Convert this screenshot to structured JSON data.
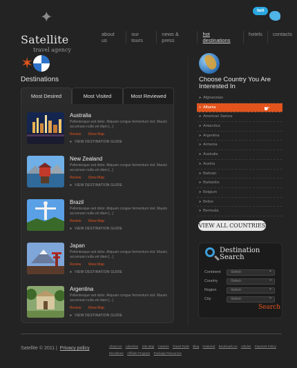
{
  "logo": {
    "name": "Satellite",
    "tagline": "travel agency"
  },
  "header": {
    "twit_label": "twit"
  },
  "nav": [
    "about us",
    "our tours",
    "news & press",
    "hot destinations",
    "hotels",
    "contacts"
  ],
  "destinations": {
    "title": "Destinations",
    "tabs": [
      "Most Desired",
      "Most Visited",
      "Most Reviewed"
    ],
    "items": [
      {
        "title": "Australia",
        "desc": "Pellentesque sed dolor. Aliquam congue fermentum nisl. Mauris accumsan nulla vel diam [...]",
        "review": "Review",
        "map": "Show Map",
        "guide": "VIEW DESTINATION GUIDE"
      },
      {
        "title": "New Zealand",
        "desc": "Pellentesque sed dolor. Aliquam congue fermentum nisl. Mauris accumsan nulla vel diam [...]",
        "review": "Review",
        "map": "Show Map",
        "guide": "VIEW DESTINATION GUIDE"
      },
      {
        "title": "Brazil",
        "desc": "Pellentesque sed dolor. Aliquam congue fermentum nisl. Mauris accumsan nulla vel diam [...]",
        "review": "Review",
        "map": "Show Map",
        "guide": "VIEW DESTINATION GUIDE"
      },
      {
        "title": "Japan",
        "desc": "Pellentesque sed dolor. Aliquam congue fermentum nisl. Mauris accumsan nulla vel diam [...]",
        "review": "Review",
        "map": "Show Map",
        "guide": "VIEW DESTINATION GUIDE"
      },
      {
        "title": "Argentina",
        "desc": "Pellentesque sed dolor. Aliquam congue fermentum nisl. Mauris accumsan nulla vel diam [...]",
        "review": "Review",
        "map": "Show Map",
        "guide": "VIEW DESTINATION GUIDE"
      }
    ]
  },
  "countries": {
    "title": "Choose Country You Are Interested In",
    "list": [
      "Afghanistan",
      "Albania",
      "American Samoa",
      "Antarctica",
      "Argentina",
      "Armenia",
      "Australia",
      "Austria",
      "Bahrain",
      "Barbados",
      "Belgium",
      "Belize",
      "Bermuda"
    ],
    "selected": "Albania",
    "view_all": "VIEW ALL COUNTRIES"
  },
  "search": {
    "title_line1": "Destination",
    "title_line2": "Search",
    "fields": [
      {
        "label": "Continent",
        "value": "-Select-"
      },
      {
        "label": "Country",
        "value": "-Select-"
      },
      {
        "label": "Region",
        "value": "-Select-"
      },
      {
        "label": "City",
        "value": "-Select-"
      }
    ],
    "button": "Search"
  },
  "footer": {
    "copyright": "Satellite © 2011 |",
    "privacy": "Privacy policy",
    "links": [
      "About Us",
      "Advertise",
      "Site Map",
      "Careers",
      "Travel Tools",
      "Blog",
      "Featured",
      "Bookmark Us",
      "Articles",
      "Payment Policy",
      "Disclaimer",
      "Affiliate Program",
      "Package Resources"
    ]
  },
  "colors": {
    "accent": "#e3541e",
    "background": "#232323",
    "panel": "#2a2a2a"
  }
}
